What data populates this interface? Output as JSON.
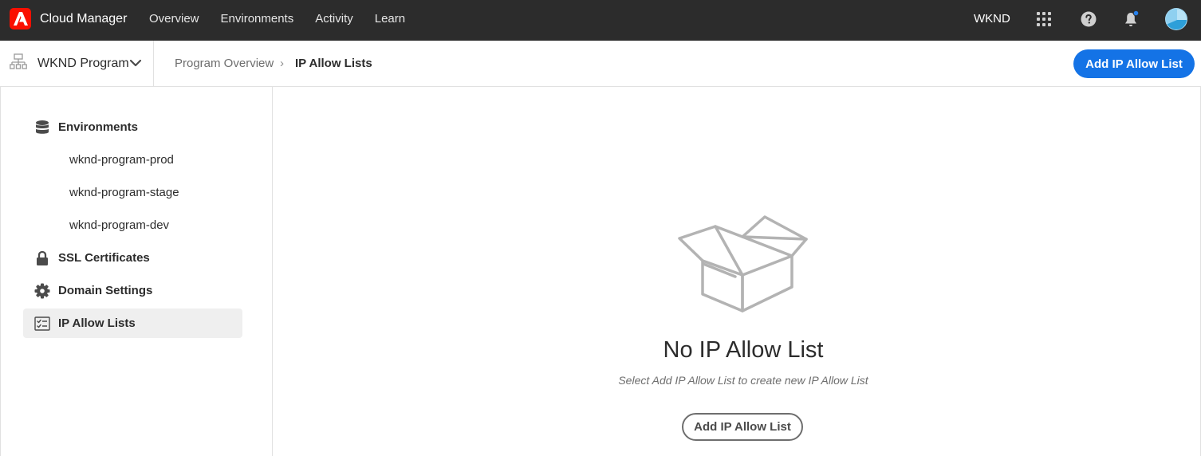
{
  "topbar": {
    "app_name": "Cloud Manager",
    "nav": [
      "Overview",
      "Environments",
      "Activity",
      "Learn"
    ],
    "org": "WKND",
    "icons": [
      "apps-grid-icon",
      "help-icon",
      "notification-bell-icon",
      "user-avatar"
    ],
    "brand_color": "#fa0f00"
  },
  "program": {
    "name": "WKND Program",
    "breadcrumb": [
      "Program Overview",
      "IP Allow Lists"
    ],
    "primary_action": "Add IP Allow List",
    "accent_color": "#1473e6"
  },
  "sidebar": {
    "sections": [
      {
        "label": "Environments",
        "icon": "database-icon",
        "active": false
      },
      {
        "label": "SSL Certificates",
        "icon": "lock-icon",
        "active": false
      },
      {
        "label": "Domain Settings",
        "icon": "gear-icon",
        "active": false
      },
      {
        "label": "IP Allow Lists",
        "icon": "checklist-icon",
        "active": true
      }
    ],
    "environments": [
      "wknd-program-prod",
      "wknd-program-stage",
      "wknd-program-dev"
    ]
  },
  "empty_state": {
    "illustration": "open-box-icon",
    "title": "No IP Allow List",
    "subtitle": "Select Add IP Allow List to create new IP Allow List",
    "action": "Add IP Allow List"
  }
}
